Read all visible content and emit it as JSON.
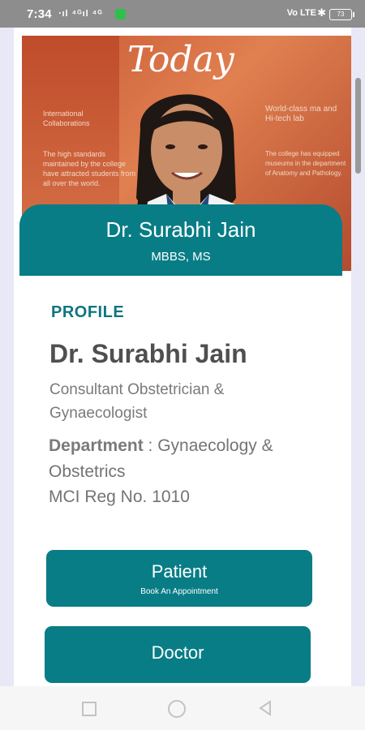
{
  "status_bar": {
    "time": "7:34",
    "signal": "‧ıl ⁴ᴳıl ⁴ᴳ",
    "right_icons": "Vo LTE",
    "battery": "73"
  },
  "profile_card": {
    "name": "Dr. Surabhi Jain",
    "qualification": "MBBS, MS"
  },
  "profile": {
    "section_title": "PROFILE",
    "name": "Dr. Surabhi Jain",
    "role": "Consultant Obstetrician & Gynaecologist",
    "department_label": "Department",
    "department_value": " : Gynaecology & Obstetrics",
    "registration": "MCI Reg No. 1010"
  },
  "buttons": {
    "patient_label": "Patient",
    "patient_sub": "Book An Appointment",
    "doctor_label": "Doctor"
  },
  "colors": {
    "accent": "#087d86",
    "section_title": "#0f7580"
  }
}
